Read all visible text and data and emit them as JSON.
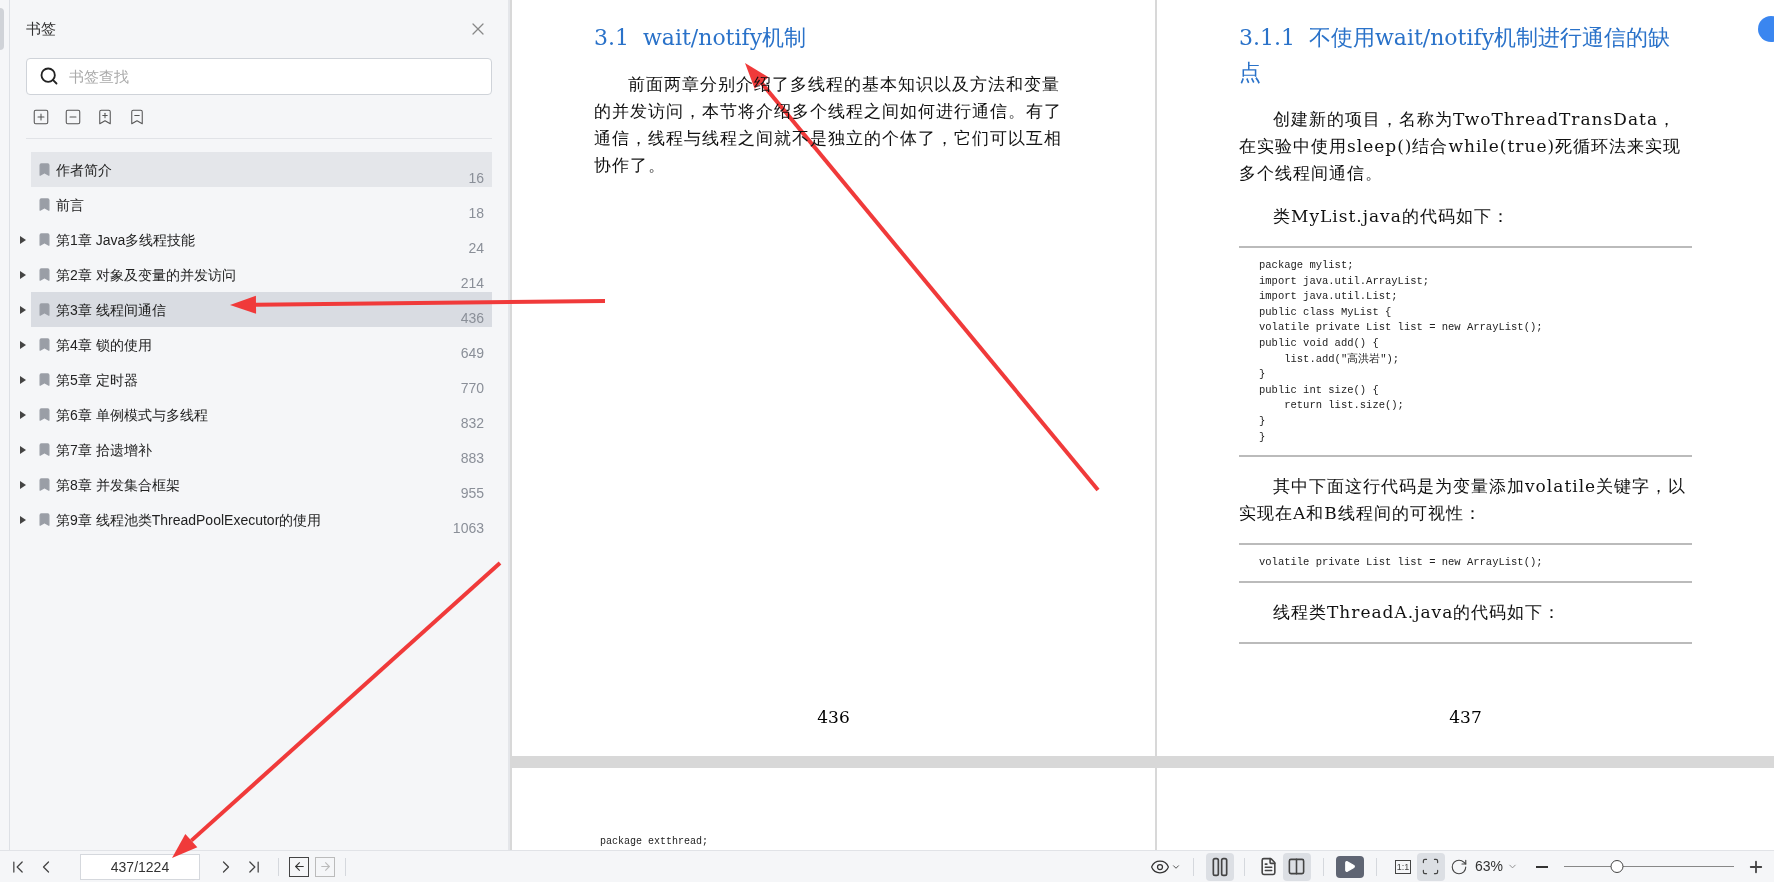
{
  "sidebar": {
    "title": "书签",
    "search": {
      "placeholder": "书签查找"
    },
    "items": [
      {
        "kind": "entry",
        "label": "作者简介",
        "page": "16",
        "selected": false,
        "highlighted": true
      },
      {
        "kind": "entry",
        "label": "前言",
        "page": "18",
        "selected": false,
        "highlighted": false
      },
      {
        "kind": "chapter",
        "label": "第1章 Java多线程技能",
        "page": "24",
        "selected": false,
        "highlighted": false,
        "expanded": false
      },
      {
        "kind": "chapter",
        "label": "第2章 对象及变量的并发访问",
        "page": "214",
        "selected": false,
        "highlighted": false,
        "expanded": false
      },
      {
        "kind": "chapter",
        "label": "第3章 线程间通信",
        "page": "436",
        "selected": true,
        "highlighted": false,
        "expanded": false
      },
      {
        "kind": "chapter",
        "label": "第4章 锁的使用",
        "page": "649",
        "selected": false,
        "highlighted": false,
        "expanded": false
      },
      {
        "kind": "chapter",
        "label": "第5章 定时器",
        "page": "770",
        "selected": false,
        "highlighted": false,
        "expanded": false
      },
      {
        "kind": "chapter",
        "label": "第6章 单例模式与多线程",
        "page": "832",
        "selected": false,
        "highlighted": false,
        "expanded": false
      },
      {
        "kind": "chapter",
        "label": "第7章 拾遗增补",
        "page": "883",
        "selected": false,
        "highlighted": false,
        "expanded": false
      },
      {
        "kind": "chapter",
        "label": "第8章 并发集合框架",
        "page": "955",
        "selected": false,
        "highlighted": false,
        "expanded": false
      },
      {
        "kind": "chapter",
        "label": "第9章 线程池类ThreadPoolExecutor的使用",
        "page": "1063",
        "selected": false,
        "highlighted": false,
        "expanded": false
      }
    ]
  },
  "pages": [
    {
      "number": "436",
      "blocks": [
        {
          "kind": "heading",
          "text": "3.1  wait/notify机制"
        },
        {
          "kind": "paragraph",
          "text": "前面两章分别介绍了多线程的基本知识以及方法和变量的并发访问，本节将介绍多个线程之间如何进行通信。有了通信，线程与线程之间就不是独立的个体了，它们可以互相协作了。"
        }
      ]
    },
    {
      "number": "437",
      "blocks": [
        {
          "kind": "heading",
          "text": "3.1.1  不使用wait/notify机制进行通信的缺点"
        },
        {
          "kind": "paragraph",
          "text": "创建新的项目，名称为TwoThreadTransData，在实验中使用sleep()结合while(true)死循环法来实现多个线程间通信。"
        },
        {
          "kind": "paragraph",
          "text": "类MyList.java的代码如下："
        },
        {
          "kind": "code",
          "lines": [
            "package mylist;",
            "import java.util.ArrayList;",
            "import java.util.List;",
            "public class MyList {",
            "volatile private List list = new ArrayList();",
            "public void add() {",
            "    list.add(\"高洪岩\");",
            "}",
            "public int size() {",
            "    return list.size();",
            "}",
            "}"
          ]
        },
        {
          "kind": "paragraph",
          "text": "其中下面这行代码是为变量添加volatile关键字，以实现在A和B线程间的可视性："
        },
        {
          "kind": "code",
          "lines": [
            "volatile private List list = new ArrayList();"
          ]
        },
        {
          "kind": "paragraph",
          "text": "线程类ThreadA.java的代码如下："
        },
        {
          "kind": "rule"
        }
      ]
    },
    {
      "blocks": [
        {
          "kind": "code_tail",
          "lines": [
            "package extthread;"
          ]
        }
      ]
    }
  ],
  "toolbar": {
    "page_field": {
      "value": "437/1224"
    },
    "back_disabled": false,
    "forward_disabled": true,
    "view_buttons": [
      {
        "kind": "continuous",
        "selected": true
      },
      {
        "kind": "single",
        "selected": false
      },
      {
        "kind": "double",
        "selected": true
      }
    ],
    "fit_buttons": [
      {
        "kind": "actual",
        "label": "1:1",
        "selected": false
      },
      {
        "kind": "fit",
        "selected": true
      },
      {
        "kind": "rotate",
        "selected": false
      }
    ],
    "zoom": {
      "text": "63%",
      "level": 0.31
    }
  }
}
